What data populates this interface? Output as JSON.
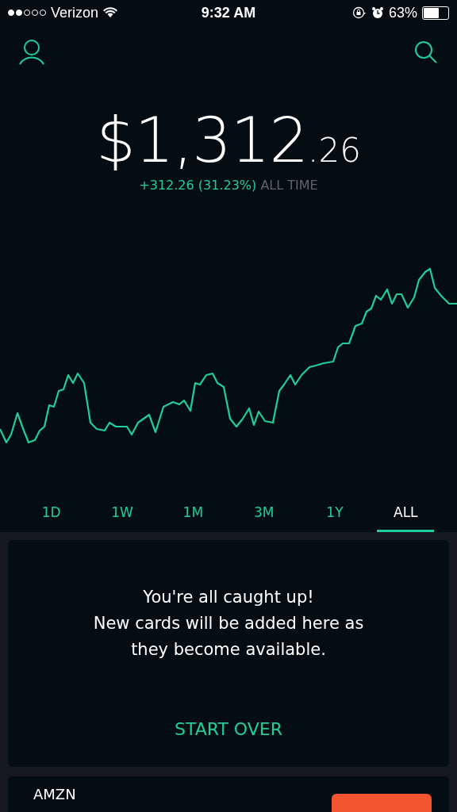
{
  "status_bar": {
    "carrier": "Verizon",
    "time": "9:32 AM",
    "battery": "63%"
  },
  "portfolio": {
    "value_main": "$1,312",
    "value_cents": ".26",
    "change": "+312.26 (31.23%)",
    "change_label": "ALL TIME"
  },
  "ranges": [
    {
      "label": "1D",
      "selected": false
    },
    {
      "label": "1W",
      "selected": false
    },
    {
      "label": "1M",
      "selected": false
    },
    {
      "label": "3M",
      "selected": false
    },
    {
      "label": "1Y",
      "selected": false
    },
    {
      "label": "ALL",
      "selected": true
    }
  ],
  "cards": [
    {
      "kind": "message",
      "lines": [
        "You're all caught up!",
        "New cards will be added here as",
        "they become available."
      ],
      "action": "START OVER"
    },
    {
      "kind": "stock",
      "symbol": "AMZN"
    }
  ]
}
